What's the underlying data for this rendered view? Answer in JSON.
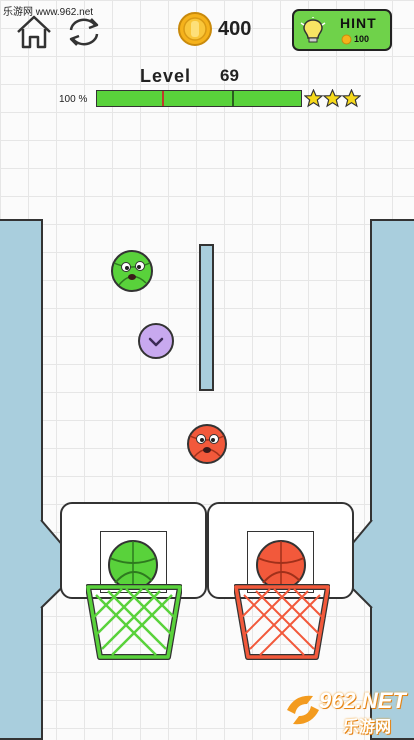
{
  "watermark_top": "乐游网 www.962.net",
  "header": {
    "coins": "400",
    "hint_label": "HINT",
    "hint_cost": "100"
  },
  "level": {
    "label": "Level",
    "number": "69",
    "progress_text": "100 %",
    "progress_fraction": 1.0,
    "stars_earned": 3,
    "stars_total": 3
  },
  "balls": [
    {
      "name": "green-face-ball",
      "color": "#59d23b"
    },
    {
      "name": "red-face-ball",
      "color": "#f2593b"
    }
  ],
  "baskets": [
    {
      "name": "green-basket",
      "color": "#59d23b"
    },
    {
      "name": "red-basket",
      "color": "#f2593b"
    }
  ],
  "watermark_bottom": {
    "brand": "962.NET",
    "sub": "乐游网"
  },
  "colors": {
    "wall": "#a9cedd",
    "green": "#59d23b",
    "red": "#f2593b",
    "purple": "#c8a9ef",
    "star": "#f6d91b"
  }
}
